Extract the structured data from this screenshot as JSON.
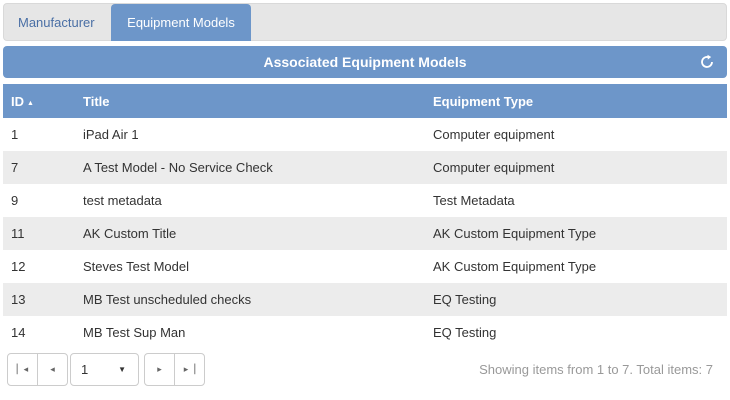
{
  "tabs": [
    {
      "label": "Manufacturer",
      "active": false
    },
    {
      "label": "Equipment Models",
      "active": true
    }
  ],
  "panel": {
    "title": "Associated Equipment Models",
    "refresh_icon": "refresh-icon"
  },
  "table": {
    "columns": [
      "ID",
      "Title",
      "Equipment Type"
    ],
    "sort_icon": "sort-ascending-icon",
    "rows": [
      {
        "id": "1",
        "title": "iPad Air 1",
        "type": "Computer equipment"
      },
      {
        "id": "7",
        "title": "A Test Model - No Service Check",
        "type": "Computer equipment"
      },
      {
        "id": "9",
        "title": "test metadata",
        "type": "Test Metadata"
      },
      {
        "id": "11",
        "title": "AK Custom Title",
        "type": "AK Custom Equipment Type"
      },
      {
        "id": "12",
        "title": "Steves Test Model",
        "type": "AK Custom Equipment Type"
      },
      {
        "id": "13",
        "title": "MB Test unscheduled checks",
        "type": "EQ Testing"
      },
      {
        "id": "14",
        "title": "MB Test Sup Man",
        "type": "EQ Testing"
      }
    ]
  },
  "pager": {
    "current_page": "1",
    "info": "Showing items from 1 to 7. Total items: 7"
  },
  "colors": {
    "accent": "#6d96c9",
    "row_alt": "#ececec",
    "tab_text": "#4a6fa5"
  }
}
